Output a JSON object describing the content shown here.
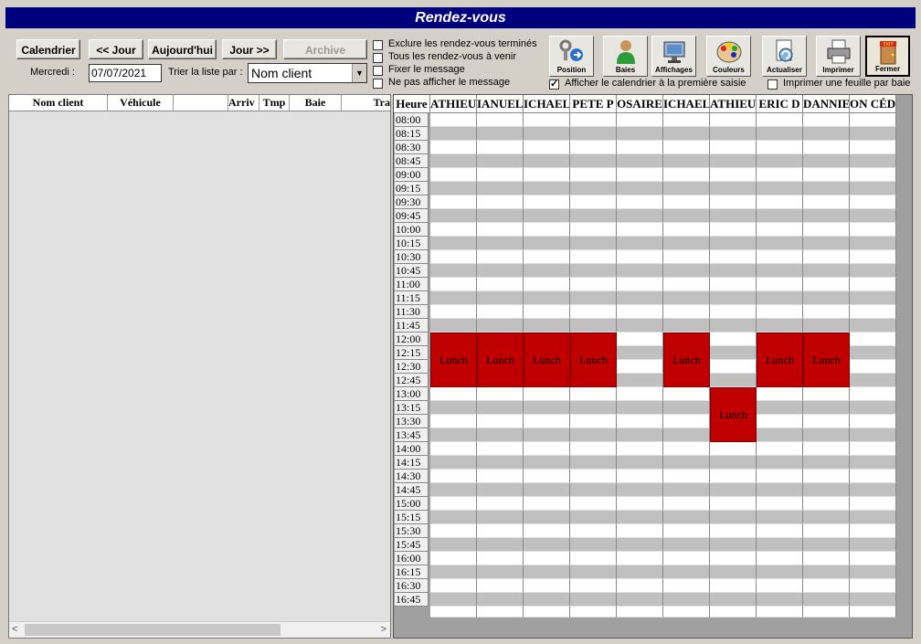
{
  "window": {
    "title": "Rendez-vous"
  },
  "toolbar": {
    "calendar_label": "Calendrier",
    "prev_day_label": "<< Jour",
    "today_label": "Aujourd'hui",
    "next_day_label": "Jour >>",
    "archive_label": "Archive",
    "day_name": "Mercredi :",
    "date_value": "07/07/2021",
    "sort_label": "Trier la liste par :",
    "sort_value": "Nom client"
  },
  "options": [
    {
      "label": "Exclure les rendez-vous terminés",
      "checked": false
    },
    {
      "label": "Tous les rendez-vous à venir",
      "checked": false
    },
    {
      "label": "Fixer le message",
      "checked": false
    },
    {
      "label": "Ne pas afficher le message",
      "checked": false
    }
  ],
  "tools": [
    {
      "label": "Position",
      "icon": "position-icon"
    },
    {
      "label": "Baies",
      "icon": "person-icon"
    },
    {
      "label": "Affichages",
      "icon": "monitor-icon"
    },
    {
      "label": "Couleurs",
      "icon": "palette-icon"
    },
    {
      "label": "Actualiser",
      "icon": "refresh-document-icon"
    },
    {
      "label": "Imprimer",
      "icon": "printer-icon"
    },
    {
      "label": "Fermer",
      "icon": "exit-door-icon"
    }
  ],
  "tool_options": [
    {
      "label": "Afficher le calendrier à la première saisie",
      "checked": true
    },
    {
      "label": "Imprimer une feuille par baie",
      "checked": false
    }
  ],
  "list": {
    "columns": [
      "Nom client",
      "Véhicule",
      "",
      "Arriv",
      "Tmp",
      "Baie",
      "Tra"
    ]
  },
  "schedule": {
    "hour_header": "Heure",
    "technicians": [
      "ATHIEU",
      "IANUEL",
      "ICHAEL",
      "PETE P",
      "OSAIRE",
      "ICHAEL",
      "ATHIEU",
      "ERIC D",
      "DANNIE",
      "ON CÉDUL"
    ],
    "times": [
      "08:00",
      "08:15",
      "08:30",
      "08:45",
      "09:00",
      "09:15",
      "09:30",
      "09:45",
      "10:00",
      "10:15",
      "10:30",
      "10:45",
      "11:00",
      "11:15",
      "11:30",
      "11:45",
      "12:00",
      "12:15",
      "12:30",
      "12:45",
      "13:00",
      "13:15",
      "13:30",
      "13:45",
      "14:00",
      "14:15",
      "14:30",
      "14:45",
      "15:00",
      "15:15",
      "15:30",
      "15:45",
      "16:00",
      "16:15",
      "16:30",
      "16:45"
    ],
    "lunch_label": "Lunch",
    "lunch_color": "#c00000",
    "appointments": [
      {
        "col": 0,
        "start": "12:00",
        "end": "13:00",
        "label": "Lunch"
      },
      {
        "col": 1,
        "start": "12:00",
        "end": "13:00",
        "label": "Lunch"
      },
      {
        "col": 2,
        "start": "12:00",
        "end": "13:00",
        "label": "Lunch"
      },
      {
        "col": 3,
        "start": "12:00",
        "end": "13:00",
        "label": "Lunch"
      },
      {
        "col": 5,
        "start": "12:00",
        "end": "13:00",
        "label": "Lunch"
      },
      {
        "col": 6,
        "start": "13:00",
        "end": "14:00",
        "label": "Lunch"
      },
      {
        "col": 7,
        "start": "12:00",
        "end": "13:00",
        "label": "Lunch"
      },
      {
        "col": 8,
        "start": "12:00",
        "end": "13:00",
        "label": "Lunch"
      }
    ]
  }
}
